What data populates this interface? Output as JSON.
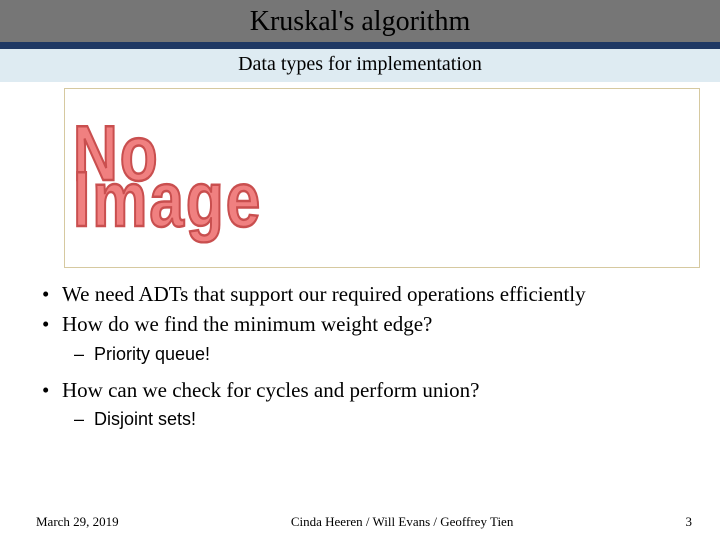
{
  "title": "Kruskal's algorithm",
  "subtitle": "Data types for implementation",
  "figure": {
    "placeholder_line1": "No",
    "placeholder_line2": "Image"
  },
  "bullets": {
    "b1": "We need ADTs that support our required operations efficiently",
    "b2": "How do we find the minimum weight edge?",
    "b2_sub": "Priority queue!",
    "b3": "How can we check for cycles and perform union?",
    "b3_sub": "Disjoint sets!"
  },
  "footer": {
    "date": "March 29, 2019",
    "authors": "Cinda Heeren / Will Evans / Geoffrey Tien",
    "page": "3"
  }
}
